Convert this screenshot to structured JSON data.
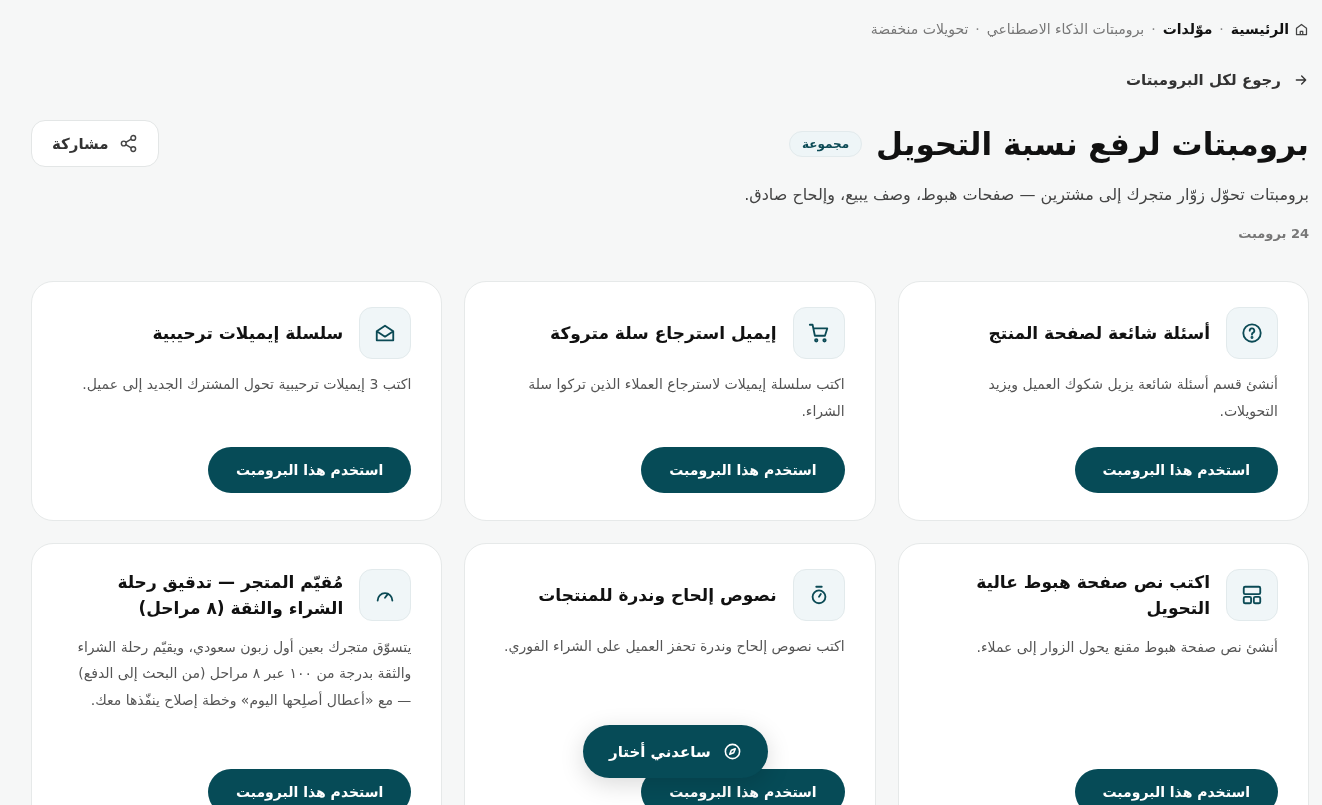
{
  "breadcrumbs": {
    "separator": "·",
    "items": [
      {
        "label": "الرئيسية",
        "kind": "home",
        "emphasis": true
      },
      {
        "label": "موّلدات",
        "kind": "link",
        "emphasis": true
      },
      {
        "label": "برومبتات الذكاء الاصطناعي",
        "kind": "link",
        "emphasis": false
      },
      {
        "label": "تحويلات منخفضة",
        "kind": "link",
        "emphasis": false
      }
    ]
  },
  "back_link": {
    "label": "رجوع لكل البرومبتات"
  },
  "header": {
    "title": "برومبتات لرفع نسبة التحويل",
    "badge": "مجموعة",
    "share_button": "مشاركة",
    "subtitle": "برومبتات تحوّل زوّار متجرك إلى مشترين — صفحات هبوط، وصف يبيع، وإلحاح صادق.",
    "count": "24 برومبت"
  },
  "cards": [
    {
      "title": "أسئلة شائعة لصفحة المنتج",
      "description": "أنشئ قسم أسئلة شائعة يزيل شكوك العميل ويزيد التحويلات.",
      "button": "استخدم هذا البرومبت"
    },
    {
      "title": "إيميل استرجاع سلة متروكة",
      "description": "اكتب سلسلة إيميلات لاسترجاع العملاء الذين تركوا سلة الشراء.",
      "button": "استخدم هذا البرومبت"
    },
    {
      "title": "سلسلة إيميلات ترحيبية",
      "description": "اكتب 3 إيميلات ترحيبية تحول المشترك الجديد إلى عميل.",
      "button": "استخدم هذا البرومبت"
    },
    {
      "title": "اكتب نص صفحة هبوط عالية التحويل",
      "description": "أنشئ نص صفحة هبوط مقنع يحول الزوار إلى عملاء.",
      "button": "استخدم هذا البرومبت"
    },
    {
      "title": "نصوص إلحاح وندرة للمنتجات",
      "description": "اكتب نصوص إلحاح وندرة تحفز العميل على الشراء الفوري.",
      "button": "استخدم هذا البرومبت"
    },
    {
      "title": "مُقيّم المتجر — تدقيق رحلة الشراء والثقة (٨ مراحل)",
      "description": "يتسوّق متجرك بعين أول زبون سعودي، ويقيّم رحلة الشراء والثقة بدرجة من ١٠٠ عبر ٨ مراحل (من البحث إلى الدفع) — مع «أعطال أصلِحها اليوم» وخطة إصلاح ينفّذها معك.",
      "button": "استخدم هذا البرومبت"
    }
  ],
  "help_button": {
    "label": "ساعدني أختار"
  }
}
